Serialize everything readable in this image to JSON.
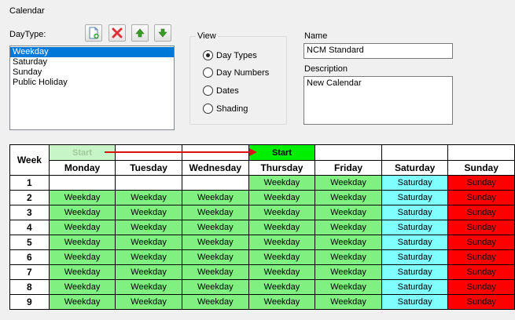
{
  "window": {
    "title": "Calendar"
  },
  "daytype": {
    "label": "DayType:",
    "items": [
      "Weekday",
      "Saturday",
      "Sunday",
      "Public Holiday"
    ],
    "selected_index": 0
  },
  "toolbar": {
    "buttons": [
      {
        "icon": "new-document-icon"
      },
      {
        "icon": "delete-x-icon",
        "color": "#e0303a"
      },
      {
        "icon": "arrow-up-icon",
        "color": "#3a9a2a"
      },
      {
        "icon": "arrow-down-icon",
        "color": "#3a9a2a"
      }
    ]
  },
  "view": {
    "title": "View",
    "options": [
      "Day Types",
      "Day Numbers",
      "Dates",
      "Shading"
    ],
    "selected_index": 0
  },
  "name": {
    "label": "Name",
    "value": "NCM Standard"
  },
  "description": {
    "label": "Description",
    "value": "New Calendar"
  },
  "calendar": {
    "week_header": "Week",
    "days": [
      "Monday",
      "Tuesday",
      "Wednesday",
      "Thursday",
      "Friday",
      "Saturday",
      "Sunday"
    ],
    "start_label_ghost": "Start",
    "start_label": "Start",
    "start_from_day_index": 0,
    "start_to_day_index": 3,
    "colors": {
      "start_active": "#00ee00",
      "start_ghost": "#c8f5c8",
      "arrow": "#e01010",
      "weekday": "#80f080",
      "saturday": "#80ffff",
      "sunday": "#ff0000"
    },
    "rows": [
      {
        "week": "1",
        "cells": [
          "",
          "",
          "",
          "Weekday",
          "Weekday",
          "Saturday",
          "Sunday"
        ]
      },
      {
        "week": "2",
        "cells": [
          "Weekday",
          "Weekday",
          "Weekday",
          "Weekday",
          "Weekday",
          "Saturday",
          "Sunday"
        ]
      },
      {
        "week": "3",
        "cells": [
          "Weekday",
          "Weekday",
          "Weekday",
          "Weekday",
          "Weekday",
          "Saturday",
          "Sunday"
        ]
      },
      {
        "week": "4",
        "cells": [
          "Weekday",
          "Weekday",
          "Weekday",
          "Weekday",
          "Weekday",
          "Saturday",
          "Sunday"
        ]
      },
      {
        "week": "5",
        "cells": [
          "Weekday",
          "Weekday",
          "Weekday",
          "Weekday",
          "Weekday",
          "Saturday",
          "Sunday"
        ]
      },
      {
        "week": "6",
        "cells": [
          "Weekday",
          "Weekday",
          "Weekday",
          "Weekday",
          "Weekday",
          "Saturday",
          "Sunday"
        ]
      },
      {
        "week": "7",
        "cells": [
          "Weekday",
          "Weekday",
          "Weekday",
          "Weekday",
          "Weekday",
          "Saturday",
          "Sunday"
        ]
      },
      {
        "week": "8",
        "cells": [
          "Weekday",
          "Weekday",
          "Weekday",
          "Weekday",
          "Weekday",
          "Saturday",
          "Sunday"
        ]
      },
      {
        "week": "9",
        "cells": [
          "Weekday",
          "Weekday",
          "Weekday",
          "Weekday",
          "Weekday",
          "Saturday",
          "Sunday"
        ]
      }
    ]
  }
}
